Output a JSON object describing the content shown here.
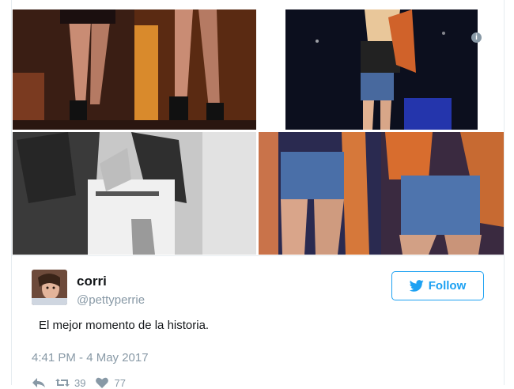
{
  "tweet": {
    "author_name": "corri",
    "author_handle": "@pettyperrie",
    "text": "El mejor momento de la historia.",
    "timestamp": "4:41 PM - 4 May 2017",
    "follow_label": "Follow",
    "retweet_count": "39",
    "like_count": "77"
  },
  "colors": {
    "accent": "#1da1f2",
    "muted": "#8899a6",
    "text": "#14171a"
  },
  "icons": [
    "info-icon",
    "bird-icon",
    "reply-icon",
    "retweet-icon",
    "like-icon"
  ]
}
